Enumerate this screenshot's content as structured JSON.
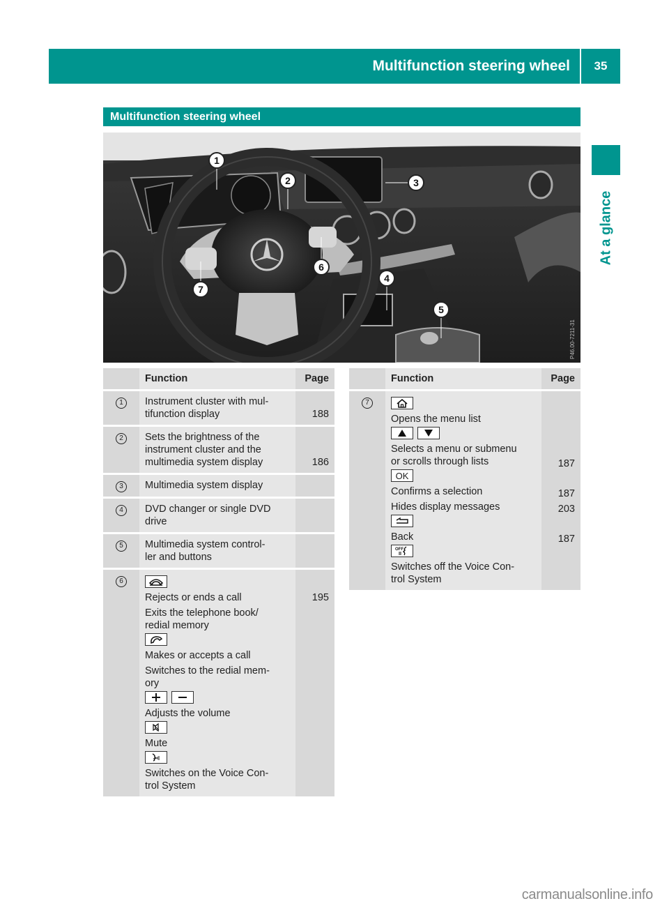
{
  "header": {
    "running_title": "Multifunction steering wheel",
    "page_number": "35",
    "side_tab_label": "At a glance",
    "accent_color": "#00958f"
  },
  "section": {
    "title": "Multifunction steering wheel"
  },
  "photo": {
    "description": "Dashboard with steering wheel, instrument cluster, multimedia display and controller",
    "callouts": [
      "1",
      "2",
      "3",
      "4",
      "5",
      "6",
      "7"
    ],
    "image_code": "P46.00-7211-31"
  },
  "table_left": {
    "headers": {
      "num": "",
      "function": "Function",
      "page": "Page"
    },
    "rows": [
      {
        "num": "1",
        "lines": [
          "Instrument cluster with mul-",
          "tifunction display"
        ],
        "page": "188"
      },
      {
        "num": "2",
        "lines": [
          "Sets the brightness of the",
          "instrument cluster and the",
          "multimedia system display"
        ],
        "page": "186"
      },
      {
        "num": "3",
        "lines": [
          "Multimedia system display"
        ],
        "page": ""
      },
      {
        "num": "4",
        "lines": [
          "DVD changer or single DVD",
          "drive"
        ],
        "page": ""
      },
      {
        "num": "5",
        "lines": [
          "Multimedia system control-",
          "ler and buttons"
        ],
        "page": ""
      },
      {
        "num": "6",
        "items": [
          {
            "keys": [
              "end-call-icon"
            ]
          },
          {
            "text": "Rejects or ends a call",
            "page": "195"
          },
          {
            "text": "Exits the telephone book/",
            "text2": "redial memory"
          },
          {
            "keys": [
              "phone-accept-icon"
            ]
          },
          {
            "text": "Makes or accepts a call"
          },
          {
            "text": "Switches to the redial mem-",
            "text2": "ory"
          },
          {
            "keys": [
              "plus-icon",
              "minus-icon"
            ]
          },
          {
            "text": "Adjusts the volume"
          },
          {
            "keys": [
              "mute-icon"
            ]
          },
          {
            "text": "Mute"
          },
          {
            "keys": [
              "voice-on-icon"
            ]
          },
          {
            "text": "Switches on the Voice Con-",
            "text2": "trol System"
          }
        ]
      }
    ]
  },
  "table_right": {
    "headers": {
      "num": "",
      "function": "Function",
      "page": "Page"
    },
    "rows": [
      {
        "num": "7",
        "items": [
          {
            "keys": [
              "home-icon"
            ]
          },
          {
            "text": "Opens the menu list"
          },
          {
            "keys": [
              "up-arrow-icon",
              "down-arrow-icon"
            ]
          },
          {
            "text": "Selects a menu or submenu",
            "text2": "or scrolls through lists",
            "page": "187"
          },
          {
            "keys": [
              "ok-key"
            ],
            "key_label": "OK"
          },
          {
            "text": "Confirms a selection",
            "page": "187"
          },
          {
            "text": "Hides display messages",
            "page": "203"
          },
          {
            "keys": [
              "back-icon"
            ]
          },
          {
            "text": "Back",
            "page": "187"
          },
          {
            "keys": [
              "voice-off-icon"
            ]
          },
          {
            "text": "Switches off the Voice Con-",
            "text2": "trol System"
          }
        ]
      }
    ]
  },
  "footer": {
    "watermark": "carmanualsonline.info"
  }
}
